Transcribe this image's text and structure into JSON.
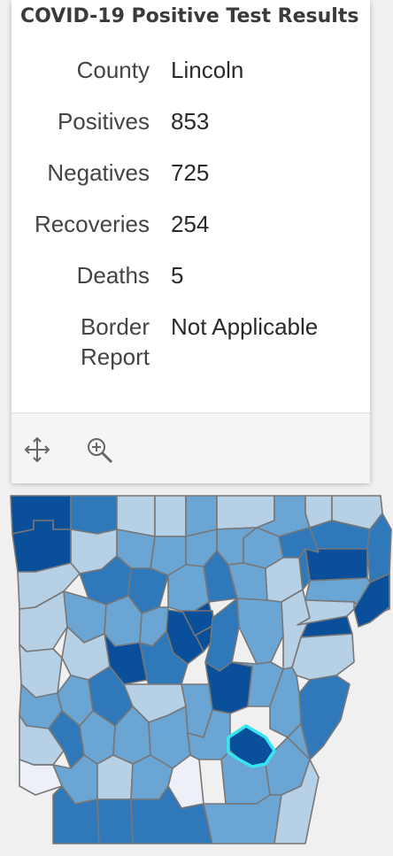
{
  "popup": {
    "title": "COVID-19 Positive Test Results",
    "fields": [
      {
        "label": "County",
        "value": "Lincoln"
      },
      {
        "label": "Positives",
        "value": "853"
      },
      {
        "label": "Negatives",
        "value": "725"
      },
      {
        "label": "Recoveries",
        "value": "254"
      },
      {
        "label": "Deaths",
        "value": "5"
      },
      {
        "label": "Border Report",
        "value": "Not Applicable"
      }
    ],
    "tools": [
      {
        "name": "pan-icon"
      },
      {
        "name": "zoom-to-icon"
      }
    ]
  },
  "map": {
    "state": "Arkansas",
    "selected_county": "Lincoln",
    "colors": {
      "darkest": "#0a4f9a",
      "dark": "#2f78b9",
      "medium": "#6ba5d4",
      "light": "#b6d0e6",
      "lightest": "#eef0f7",
      "highlight": "#35e6f2",
      "border": "#777777"
    }
  }
}
